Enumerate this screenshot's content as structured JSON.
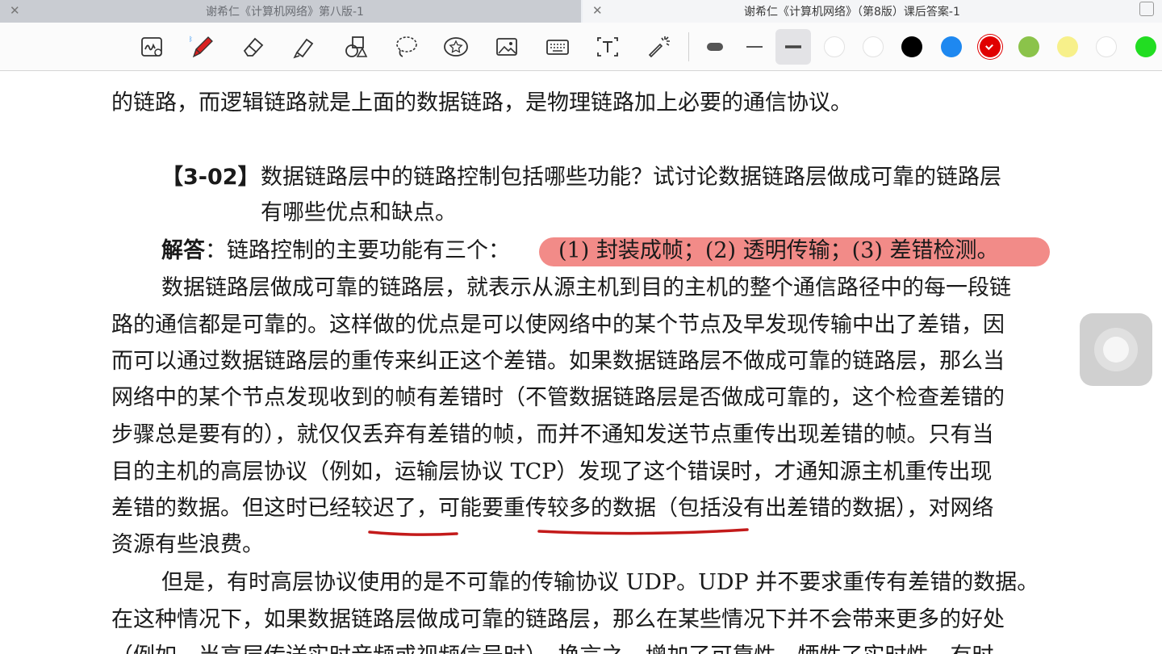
{
  "tabs": [
    {
      "title": "谢希仁《计算机网络》第八版-1",
      "active": false
    },
    {
      "title": "谢希仁《计算机网络》（第8版）课后答案-1",
      "active": true
    }
  ],
  "toolbar": {
    "tools": [
      "handwriting-insert-icon",
      "pen-icon",
      "eraser-icon",
      "highlighter-icon",
      "shapes-icon",
      "lasso-icon",
      "sticker-icon",
      "image-icon",
      "keyboard-icon",
      "text-box-icon",
      "laser-pointer-icon"
    ],
    "stroke_widths": [
      "thin",
      "medium",
      "thick"
    ],
    "selected_stroke": "thick",
    "colors": [
      "#ffffff",
      "#ffffff",
      "#000000",
      "#1e88f0",
      "#e00000",
      "#8bc34a",
      "#f7f08a",
      "#ffffff",
      "#22dd22"
    ],
    "selected_color": "#e00000"
  },
  "document": {
    "line0": "的链路，而逻辑链路就是上面的数据链路，是物理链路加上必要的通信协议。",
    "question_label": "【3-02】",
    "question_line1": "数据链路层中的链路控制包括哪些功能？试讨论数据链路层做成可靠的链路层",
    "question_line2": "有哪些优点和缺点。",
    "answer_label": "解答",
    "answer_colon": "：",
    "answer_text": "链路控制的主要功能有三个：",
    "answer_highlight": "(1) 封装成帧；(2) 透明传输；(3) 差错检测。",
    "p1": [
      "数据链路层做成可靠的链路层，就表示从源主机到目的主机的整个通信路径中的每一段链",
      "路的通信都是可靠的。这样做的优点是可以使网络中的某个节点及早发现传输中出了差错，因",
      "而可以通过数据链路层的重传来纠正这个差错。如果数据链路层不做成可靠的链路层，那么当",
      "网络中的某个节点发现收到的帧有差错时（不管数据链路层是否做成可靠的，这个检查差错的",
      "步骤总是要有的），就仅仅丢弃有差错的帧，而并不通知发送节点重传出现差错的帧。只有当",
      "目的主机的高层协议（例如，运输层协议 TCP）发现了这个错误时，才通知源主机重传出现",
      "差错的数据。但这时已经较迟了，可能要重传较多的数据（包括没有出差错的数据），对网络",
      "资源有些浪费。"
    ],
    "p2": [
      "但是，有时高层协议使用的是不可靠的传输协议 UDP。UDP 并不要求重传有差错的数据。",
      "在这种情况下，如果数据链路层做成可靠的链路层，那么在某些情况下并不会带来更多的好处",
      "（例如，当高层传送实时音频或视频信号时）。换言之，增加了可靠性，牺牲了实时性。有时"
    ]
  }
}
